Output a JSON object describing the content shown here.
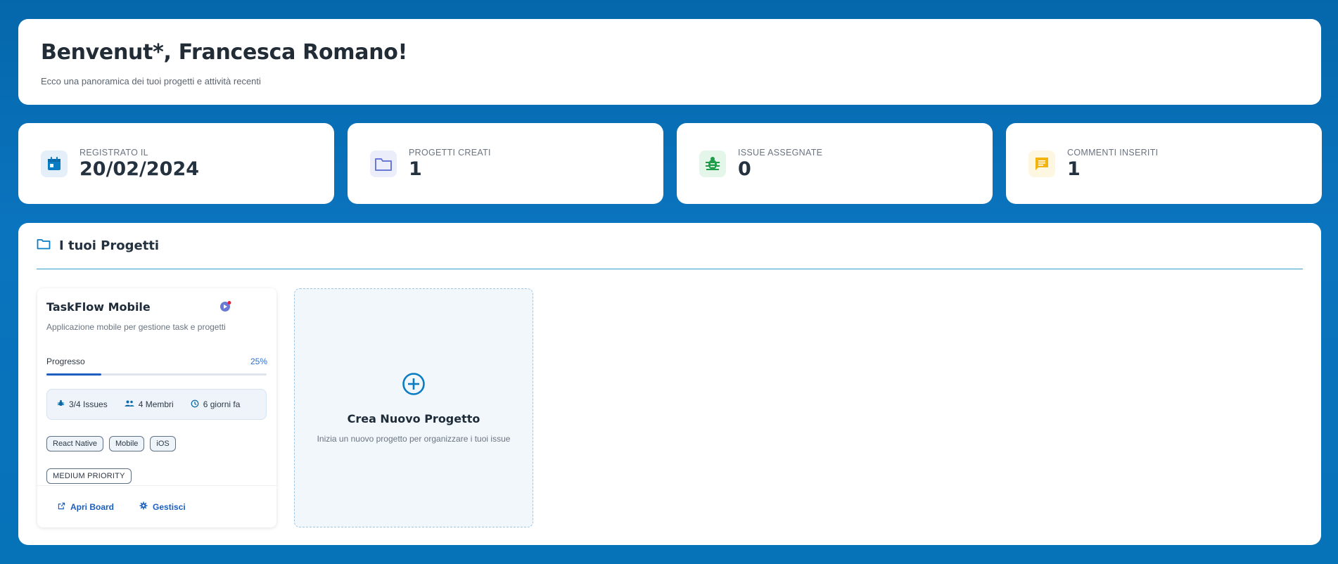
{
  "welcome": {
    "title": "Benvenut*, Francesca Romano!",
    "subtitle": "Ecco una panoramica dei tuoi progetti e attività recenti"
  },
  "stats": [
    {
      "label": "Registrato il",
      "value": "20/02/2024",
      "icon": "calendar-icon",
      "color": "#0a7cc4"
    },
    {
      "label": "Progetti creati",
      "value": "1",
      "icon": "folder-icon",
      "color": "#6a78d6"
    },
    {
      "label": "Issue assegnate",
      "value": "0",
      "icon": "bug-icon",
      "color": "#1f9d48"
    },
    {
      "label": "Commenti inseriti",
      "value": "1",
      "icon": "comment-icon",
      "color": "#f2b50f"
    }
  ],
  "projects": {
    "heading": "I tuoi Progetti",
    "items": [
      {
        "name": "TaskFlow Mobile",
        "description": "Applicazione mobile per gestione task e progetti",
        "progress_label": "Progresso",
        "progress_text": "25%",
        "progress": 0.25,
        "issues": "3/4 Issues",
        "members": "4 Membri",
        "updated": "6 giorni fa",
        "tags": [
          "React Native",
          "Mobile",
          "iOS"
        ],
        "priority": "MEDIUM PRIORITY",
        "open_board": "Apri Board",
        "manage": "Gestisci"
      }
    ],
    "new_project": {
      "title": "Crea Nuovo Progetto",
      "subtitle": "Inizia un nuovo progetto per organizzare i tuoi issue"
    }
  },
  "colors": {
    "accent": "#1a5ec0",
    "background": "#0a74be"
  }
}
